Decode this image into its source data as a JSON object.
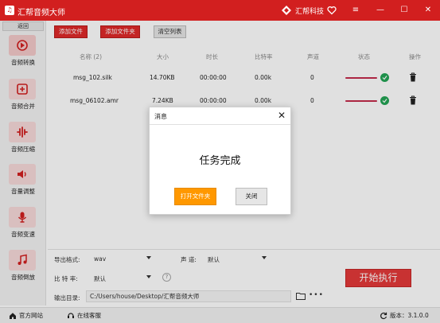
{
  "app": {
    "title": "汇帮音频大师",
    "brand_name": "汇帮科技"
  },
  "window_controls": {
    "menu": "≡",
    "minimize": "—",
    "maximize": "☐",
    "close": "✕"
  },
  "sidebar": {
    "back_label": "返回",
    "items": [
      {
        "label": "音频转换",
        "icon": "audio-convert-icon",
        "active": true
      },
      {
        "label": "音频合并",
        "icon": "audio-merge-icon"
      },
      {
        "label": "音频压缩",
        "icon": "audio-compress-icon"
      },
      {
        "label": "音量调整",
        "icon": "volume-adjust-icon"
      },
      {
        "label": "音频变速",
        "icon": "audio-speed-icon"
      },
      {
        "label": "音频倒放",
        "icon": "audio-reverse-icon"
      }
    ]
  },
  "toolbar": {
    "add_file": "添加文件",
    "add_folder": "添加文件夹",
    "clear_list": "清空列表"
  },
  "table": {
    "headers": [
      "名称 (2)",
      "大小",
      "时长",
      "比特率",
      "声道",
      "状态",
      "操作"
    ],
    "rows": [
      {
        "name": "msg_102.silk",
        "size": "14.70KB",
        "duration": "00:00:00",
        "bitrate": "0.00k",
        "channels": "0",
        "progress": 1.0
      },
      {
        "name": "msg_06102.amr",
        "size": "7.24KB",
        "duration": "00:00:00",
        "bitrate": "0.00k",
        "channels": "0",
        "progress": 1.0
      }
    ]
  },
  "options": {
    "format_label": "导出格式:",
    "format_value": "wav",
    "channel_label": "声 道:",
    "channel_value": "默认",
    "bitrate_label": "比 特 率:",
    "bitrate_value": "默认",
    "help": "?",
    "outdir_label": "输出目录:",
    "outdir_value": "C:/Users/house/Desktop/汇帮音频大师",
    "more": "•••",
    "start_button": "开始执行"
  },
  "statusbar": {
    "homepage": "官方网站",
    "support": "在线客服",
    "version": "版本：3.1.0.0"
  },
  "dialog": {
    "title": "消息",
    "close": "✕",
    "message": "任务完成",
    "open_folder": "打开文件夹",
    "close_button": "关闭"
  },
  "colors": {
    "brand_red": "#d21f1f",
    "accent_orange": "#ff9800",
    "success_green": "#23a455",
    "progress_red": "#c42c4c"
  }
}
